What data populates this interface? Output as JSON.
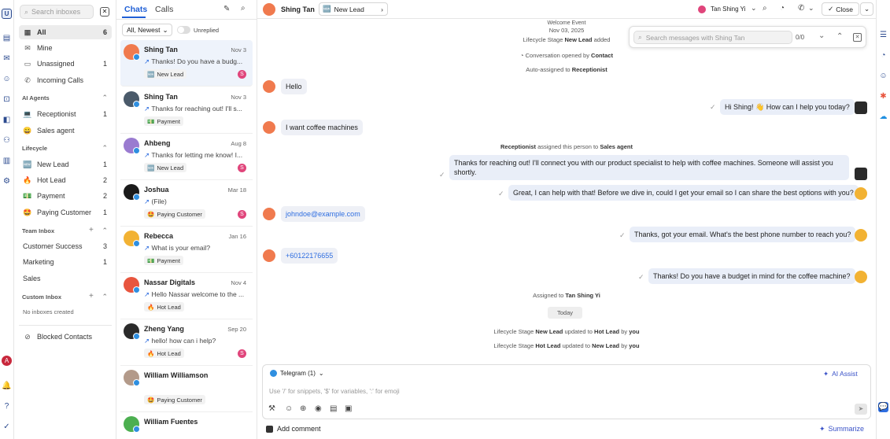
{
  "rail": {
    "brand_letter": "U",
    "user_initial": "A"
  },
  "inbox": {
    "search_placeholder": "Search inboxes",
    "items": [
      {
        "label": "All",
        "count": "6",
        "icon": "tray-icon"
      },
      {
        "label": "Mine",
        "count": "",
        "icon": "envelope-icon"
      },
      {
        "label": "Unassigned",
        "count": "1",
        "icon": "inbox-icon"
      },
      {
        "label": "Incoming Calls",
        "count": "",
        "icon": "phone-icon"
      }
    ],
    "ai_agents_title": "AI Agents",
    "ai_agents": [
      {
        "label": "Receptionist",
        "count": "1",
        "icon": "💻"
      },
      {
        "label": "Sales agent",
        "count": "",
        "icon": "😀"
      }
    ],
    "lifecycle_title": "Lifecycle",
    "lifecycle": [
      {
        "label": "New Lead",
        "count": "1",
        "icon": "🆕"
      },
      {
        "label": "Hot Lead",
        "count": "2",
        "icon": "🔥"
      },
      {
        "label": "Payment",
        "count": "2",
        "icon": "💵"
      },
      {
        "label": "Paying Customer",
        "count": "1",
        "icon": "🤩"
      }
    ],
    "team_title": "Team Inbox",
    "team": [
      {
        "label": "Customer Success",
        "count": "3"
      },
      {
        "label": "Marketing",
        "count": "1"
      },
      {
        "label": "Sales",
        "count": ""
      }
    ],
    "custom_title": "Custom Inbox",
    "custom_empty": "No inboxes created",
    "blocked": "Blocked Contacts"
  },
  "chats": {
    "tab_chats": "Chats",
    "tab_calls": "Calls",
    "filter": "All, Newest",
    "unreplied": "Unreplied",
    "list": [
      {
        "name": "Shing Tan",
        "date": "Nov 3",
        "msg": "Thanks! Do you have a budg...",
        "tag": "New Lead",
        "tag_icon": "🆕",
        "av": "#f07a4e",
        "badge": "S",
        "badge_color": "#e0457b"
      },
      {
        "name": "Shing Tan",
        "date": "Nov 3",
        "msg": "Thanks for reaching out! I'll s...",
        "tag": "Payment",
        "tag_icon": "💵",
        "av": "#4a5a6a",
        "badge": "",
        "badge_color": ""
      },
      {
        "name": "Ahbeng",
        "date": "Aug 8",
        "msg": "Thanks for letting me know! I...",
        "tag": "New Lead",
        "tag_icon": "🆕",
        "av": "#9a7bd0",
        "badge": "S",
        "badge_color": "#e0457b"
      },
      {
        "name": "Joshua",
        "date": "Mar 18",
        "msg": "(File)",
        "tag": "Paying Customer",
        "tag_icon": "🤩",
        "av": "#1a1a1a",
        "badge": "S",
        "badge_color": "#e0457b"
      },
      {
        "name": "Rebecca",
        "date": "Jan 16",
        "msg": "What is your email?",
        "tag": "Payment",
        "tag_icon": "💵",
        "av": "#f2b233",
        "badge": "",
        "badge_color": ""
      },
      {
        "name": "Nassar Digitals",
        "date": "Nov 4",
        "msg": "Hello Nassar welcome to the ...",
        "tag": "Hot Lead",
        "tag_icon": "🔥",
        "av": "#e8553e",
        "badge": "",
        "badge_color": ""
      },
      {
        "name": "Zheng Yang",
        "date": "Sep 20",
        "msg": "hello! how can i help?",
        "tag": "Hot Lead",
        "tag_icon": "🔥",
        "av": "#2a2a2a",
        "badge": "S",
        "badge_color": "#e0457b"
      },
      {
        "name": "William Williamson",
        "date": "",
        "msg": "",
        "tag": "Paying Customer",
        "tag_icon": "🤩",
        "av": "#b39a8a",
        "badge": "",
        "badge_color": ""
      },
      {
        "name": "William Fuentes",
        "date": "",
        "msg": "",
        "tag": "",
        "tag_icon": "",
        "av": "#4caf50",
        "badge": "",
        "badge_color": ""
      }
    ]
  },
  "conversation": {
    "contact": "Shing Tan",
    "lifecycle_tag": "New Lead",
    "assignee": "Tan Shing Yi",
    "close_label": "Close",
    "find_placeholder": "Search messages with Shing Tan",
    "find_count": "0/0",
    "timeline": {
      "welcome": "Welcome Event",
      "date": "Nov 03, 2025",
      "lifecycle_added": "Lifecycle Stage",
      "lifecycle_added_tag": "New Lead",
      "lifecycle_added_suffix": "added",
      "opened": "Conversation opened by",
      "opened_by": "Contact",
      "auto": "Auto-assigned to",
      "auto_to": "Receptionist"
    },
    "msgs": {
      "m1": "Hello",
      "m2": "Hi Shing! 👋 How can I help you today?",
      "m3": "I want coffee machines",
      "sys1_a": "Receptionist",
      "sys1_b": "assigned this person to",
      "sys1_c": "Sales agent",
      "m4a": "Thanks for reaching out! I'll connect you with our product specialist to help with coffee machines. Someone will assist you",
      "m4b": "shortly.",
      "m5": "Great, I can help with that! Before we dive in, could I get your email so I can share the best options with you?",
      "m6": "johndoe@example.com",
      "m7": "Thanks, got your email. What's the best phone number to reach you?",
      "m8": "+60122176655",
      "m9": "Thanks! Do you have a budget in mind for the coffee machine?",
      "sys2_a": "Assigned to",
      "sys2_b": "Tan Shing Yi",
      "today": "Today",
      "sys3_a": "Lifecycle Stage",
      "sys3_b": "New Lead",
      "sys3_c": "updated to",
      "sys3_d": "Hot Lead",
      "sys3_e": "by",
      "sys3_f": "you",
      "sys4_a": "Lifecycle Stage",
      "sys4_b": "Hot Lead",
      "sys4_c": "updated to",
      "sys4_d": "New Lead",
      "sys4_e": "by",
      "sys4_f": "you"
    },
    "composer": {
      "channel": "Telegram (1)",
      "ai_assist": "AI Assist",
      "placeholder": "Use '/' for snippets, '$' for variables, ':' for emoji"
    },
    "add_comment": "Add comment",
    "summarize": "Summarize"
  }
}
